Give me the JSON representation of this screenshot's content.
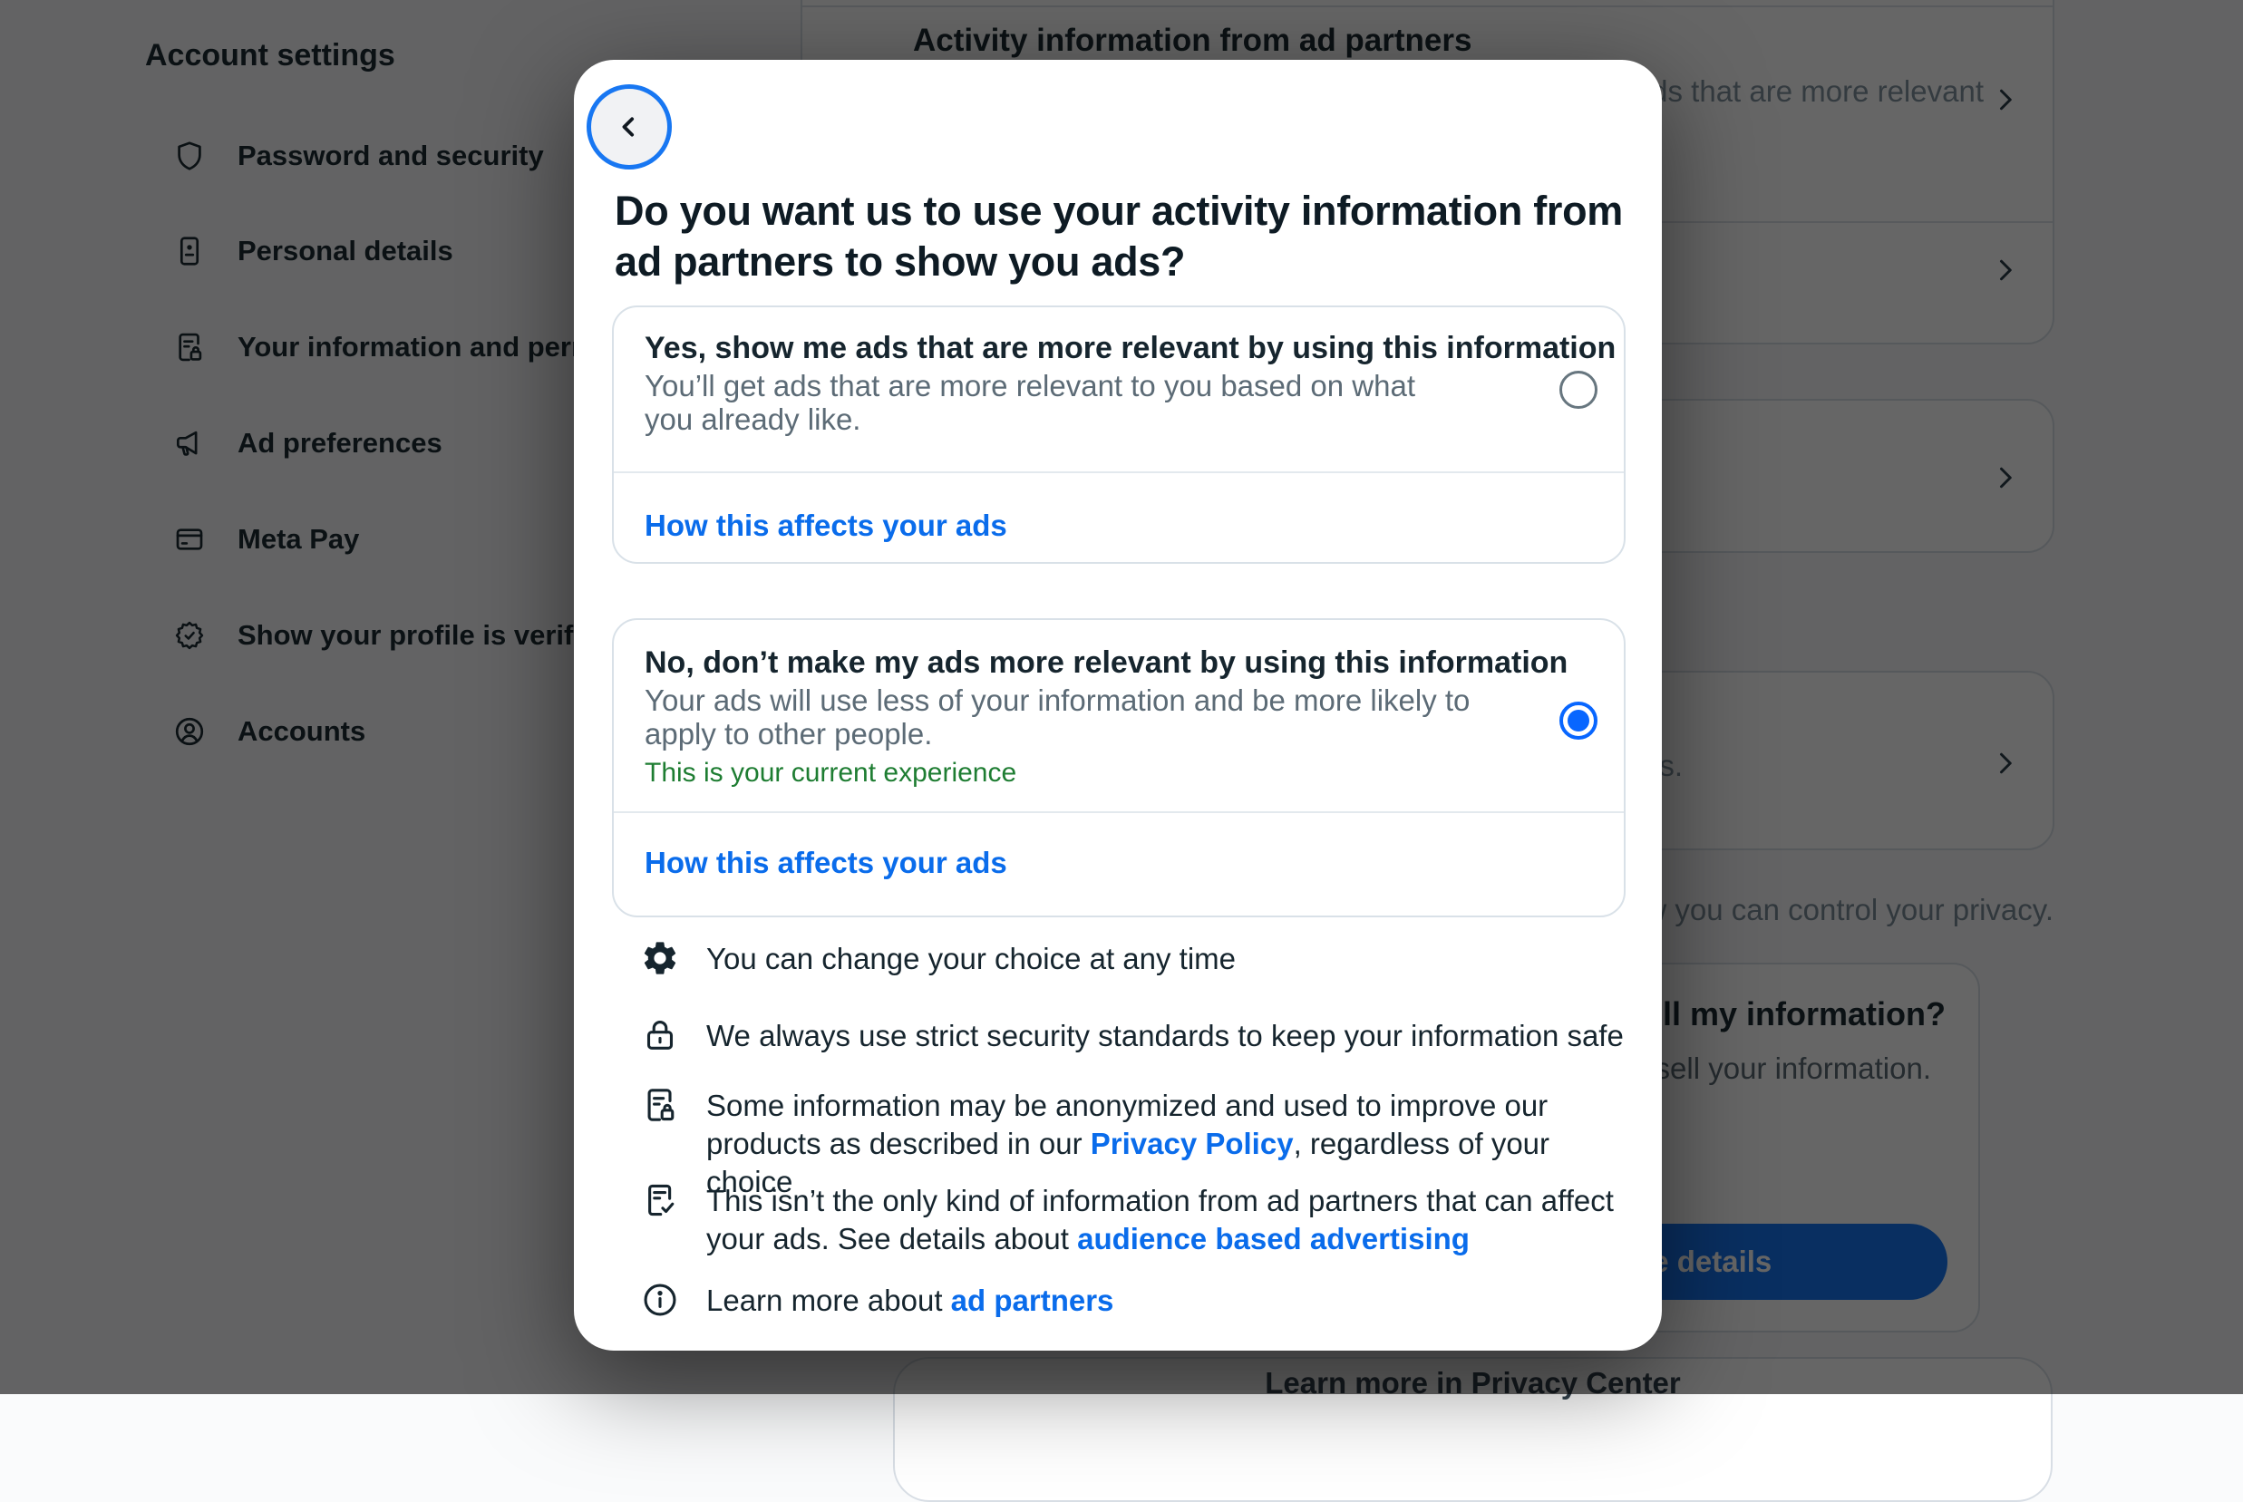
{
  "sidebar": {
    "title": "Account settings",
    "items": [
      {
        "icon": "shield-icon",
        "label": "Password and security"
      },
      {
        "icon": "id-card-icon",
        "label": "Personal details"
      },
      {
        "icon": "document-lock-icon",
        "label": "Your information and permissions"
      },
      {
        "icon": "megaphone-icon",
        "label": "Ad preferences"
      },
      {
        "icon": "credit-card-icon",
        "label": "Meta Pay"
      },
      {
        "icon": "verified-badge-icon",
        "label": "Show your profile is verified"
      },
      {
        "icon": "person-circle-icon",
        "label": "Accounts"
      }
    ]
  },
  "background": {
    "activity_card": {
      "heading": "Activity information from ad partners",
      "row1_subtitle": "See ads that are more relevant"
    },
    "ads_row_text": "Learn how this information affects your ads.",
    "privacy_note": "Learn more about how you can control your privacy.",
    "sell_card": {
      "heading": "Do we sell my information?",
      "body": "No, we never sell your information.",
      "button": "More details"
    },
    "privacy_center_link": "Learn more in Privacy Center"
  },
  "modal": {
    "title": "Do you want us to use your activity information from ad partners to show you ads?",
    "options": [
      {
        "title": "Yes, show me ads that are more relevant by using this information",
        "description": "You’ll get ads that are more relevant to you based on what you already like.",
        "link": "How this affects your ads",
        "selected": "false"
      },
      {
        "title": "No, don’t make my ads more relevant by using this information",
        "description": "Your ads will use less of your information and be more likely to apply to other people.",
        "status": "This is your current experience",
        "link": "How this affects your ads",
        "selected": "true"
      }
    ],
    "info_items": [
      {
        "icon": "gear-icon",
        "pre": "You can change your choice at any time",
        "link": "",
        "post": ""
      },
      {
        "icon": "lock-icon",
        "pre": "We always use strict security standards to keep your information safe",
        "link": "",
        "post": ""
      },
      {
        "icon": "document-lock-icon",
        "pre": "Some information may be anonymized and used to improve our products as described in our ",
        "link": "Privacy Policy",
        "post": ", regardless of your choice"
      },
      {
        "icon": "note-check-icon",
        "pre": "This isn’t the only kind of information from ad partners that can affect your ads. See details about ",
        "link": "audience based advertising",
        "post": ""
      },
      {
        "icon": "info-circle-icon",
        "pre": "Learn more about ",
        "link": "ad partners",
        "post": ""
      }
    ]
  },
  "colors": {
    "accent_blue": "#0866FF",
    "link_blue": "#0A6CEB",
    "button_blue": "#1877F2",
    "status_green": "#1E7D32",
    "text_primary": "#16252E",
    "text_secondary": "#5C6B76"
  }
}
